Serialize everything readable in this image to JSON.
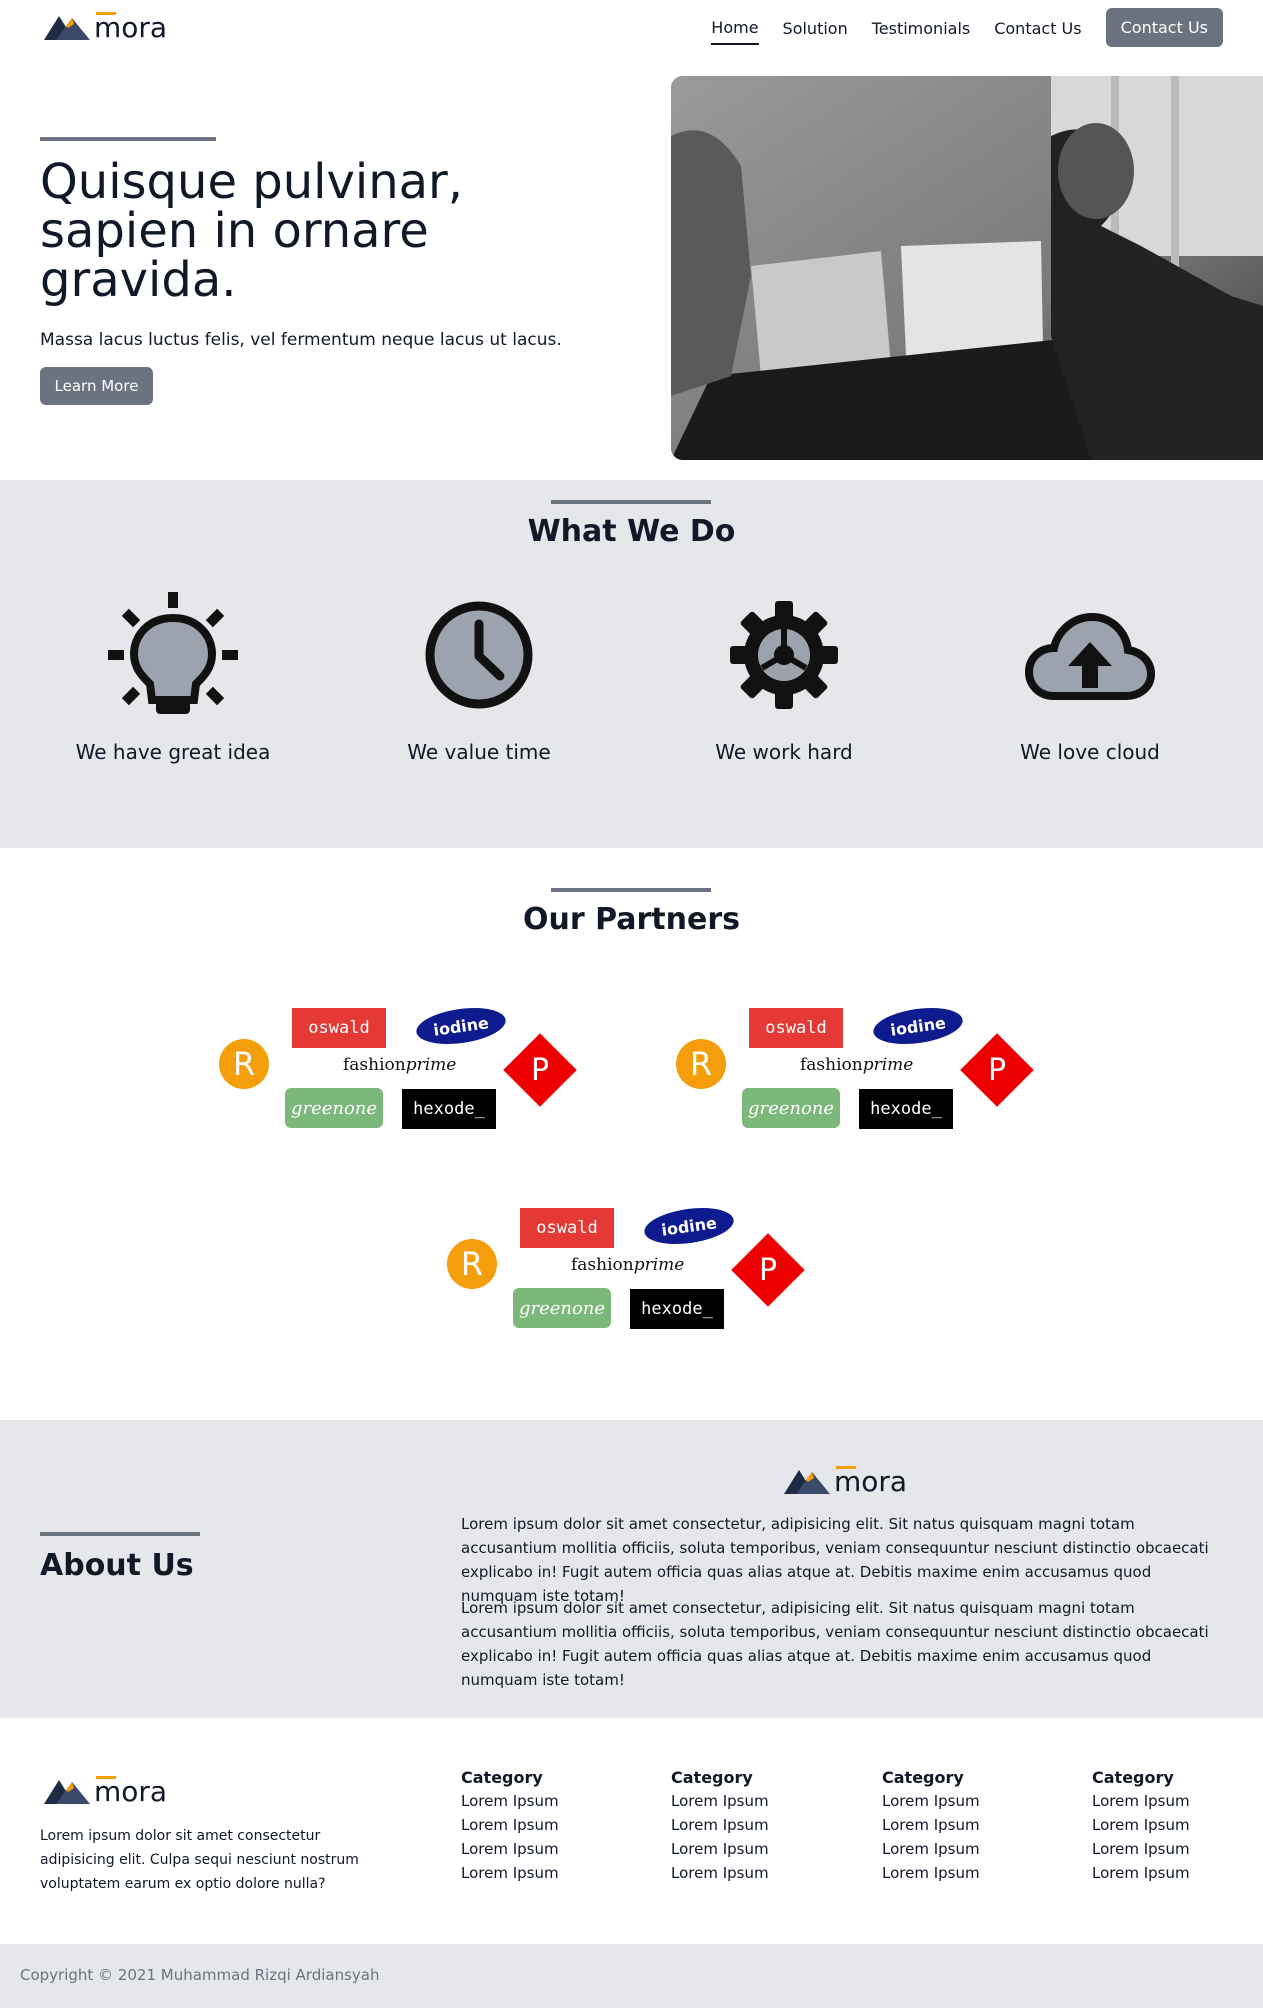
{
  "brand": {
    "name": "mora",
    "accent": "#f59e0b",
    "primary": "#6b7280"
  },
  "nav": {
    "items": [
      "Home",
      "Solution",
      "Testimonials",
      "Contact Us"
    ],
    "active": "Home",
    "cta": "Contact Us"
  },
  "hero": {
    "title": "Quisque pulvinar, sapien in ornare gravida.",
    "subtitle": "Massa lacus luctus felis, vel fermentum neque lacus ut lacus.",
    "button": "Learn More",
    "image_icon": "people-at-laptops-photo"
  },
  "what_we_do": {
    "title": "What We Do",
    "features": [
      {
        "icon": "lightbulb-icon",
        "label": "We have great idea"
      },
      {
        "icon": "clock-icon",
        "label": "We value time"
      },
      {
        "icon": "gear-icon",
        "label": "We work hard"
      },
      {
        "icon": "cloud-upload-icon",
        "label": "We love cloud"
      }
    ]
  },
  "partners": {
    "title": "Our Partners",
    "logo_texts": {
      "r": "R",
      "oswald": "oswald",
      "iodine": "iodine",
      "fashion_a": "fashion",
      "fashion_b": "prime",
      "greenone": "greenone",
      "hexode": "hexode_",
      "p": "P"
    }
  },
  "about": {
    "title": "About Us",
    "paragraphs": [
      "Lorem ipsum dolor sit amet consectetur, adipisicing elit. Sit natus quisquam magni totam accusantium mollitia officiis, soluta temporibus, veniam consequuntur nesciunt distinctio obcaecati explicabo in! Fugit autem officia quas alias atque at. Debitis maxime enim accusamus quod numquam iste totam!",
      "Lorem ipsum dolor sit amet consectetur, adipisicing elit. Sit natus quisquam magni totam accusantium mollitia officiis, soluta temporibus, veniam consequuntur nesciunt distinctio obcaecati explicabo in! Fugit autem officia quas alias atque at. Debitis maxime enim accusamus quod numquam iste totam!"
    ]
  },
  "footer": {
    "description": "Lorem ipsum dolor sit amet consectetur adipisicing elit. Culpa sequi nesciunt nostrum voluptatem earum ex optio dolore nulla?",
    "categories": [
      {
        "title": "Category",
        "items": [
          "Lorem Ipsum",
          "Lorem Ipsum",
          "Lorem Ipsum",
          "Lorem Ipsum"
        ]
      },
      {
        "title": "Category",
        "items": [
          "Lorem Ipsum",
          "Lorem Ipsum",
          "Lorem Ipsum",
          "Lorem Ipsum"
        ]
      },
      {
        "title": "Category",
        "items": [
          "Lorem Ipsum",
          "Lorem Ipsum",
          "Lorem Ipsum",
          "Lorem Ipsum"
        ]
      },
      {
        "title": "Category",
        "items": [
          "Lorem Ipsum",
          "Lorem Ipsum",
          "Lorem Ipsum",
          "Lorem Ipsum"
        ]
      }
    ],
    "copyright": "Copyright © 2021 Muhammad Rizqi Ardiansyah"
  }
}
